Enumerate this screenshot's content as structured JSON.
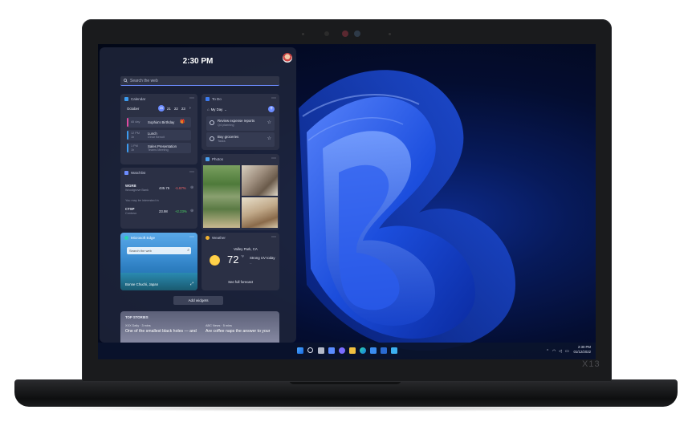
{
  "device": {
    "model": "X13"
  },
  "widgets": {
    "clock": "2:30 PM",
    "search_placeholder": "Search the web",
    "calendar": {
      "title": "Calendar",
      "month": "October",
      "days": [
        "20",
        "21",
        "22",
        "23"
      ],
      "events": [
        {
          "time": "All day",
          "title": "Sophia's Birthday",
          "sub": ""
        },
        {
          "time": "12 PM",
          "dur": "1h",
          "title": "Lunch",
          "sub": "Dinar Benoit"
        },
        {
          "time": "1 PM",
          "dur": "1h",
          "title": "Sales Presentation",
          "sub": "Teams Meeting"
        }
      ]
    },
    "todo": {
      "title": "To Do",
      "list": "My Day",
      "items": [
        {
          "title": "Review expense reports",
          "sub": "Q4 planning"
        },
        {
          "title": "Buy groceries",
          "sub": "Tasks"
        }
      ]
    },
    "photos": {
      "title": "Photos"
    },
    "watchlist": {
      "title": "Watchlist",
      "stocks": [
        {
          "symbol": "WGRB",
          "name": "Woodgrove Bank",
          "price": "435.75",
          "change": "-1.67%",
          "note": "You may be interested in"
        },
        {
          "symbol": "CTSP",
          "name": "Contoso",
          "price": "23.98",
          "change": "+2.23%"
        }
      ]
    },
    "edge": {
      "title": "Microsoft Edge",
      "search": "Search the web",
      "location": "Bonne Chuchi, Japan"
    },
    "weather": {
      "title": "Weather",
      "location": "Valley Park, CA",
      "temp": "72",
      "unit": "°F",
      "desc1": "Strong UV today",
      "desc2": "--",
      "link": "See full forecast"
    },
    "add_widgets": "Add widgets",
    "stories": {
      "title": "TOP STORIES",
      "items": [
        {
          "source": "XXX Daily · 3 mins",
          "headline": "One of the smallest black holes — and"
        },
        {
          "source": "ABC News · 5 mins",
          "headline": "Are coffee naps the answer to your"
        }
      ]
    }
  },
  "taskbar": {
    "time": "2:30 PM",
    "date": "01/12/2022"
  },
  "colors": {
    "accent": "#6c8cff",
    "negative": "#ff6b6b",
    "positive": "#4cd964",
    "todo_icon": "#3c7bf0"
  }
}
